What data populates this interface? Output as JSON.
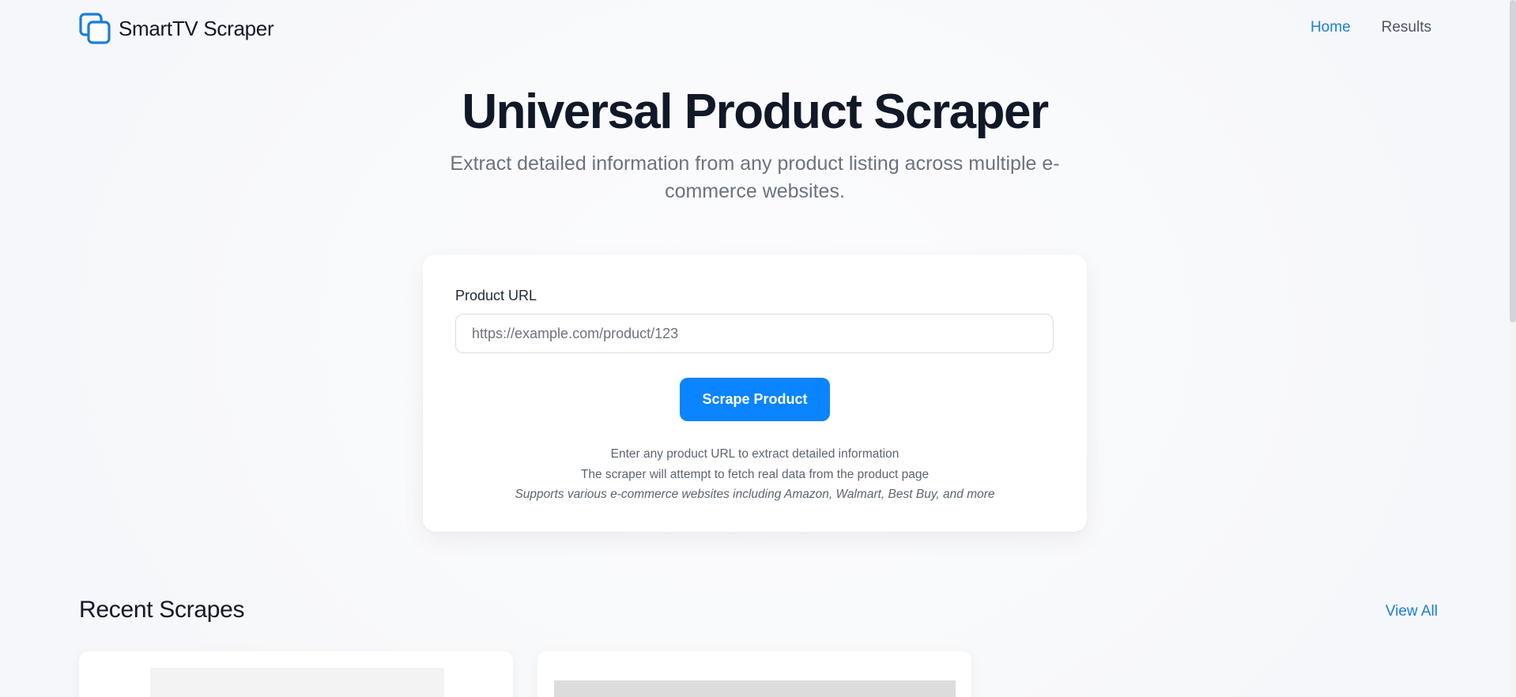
{
  "app": {
    "brand_name": "SmartTV Scraper",
    "brand_icon": "copy-squares-icon",
    "accent_color": "#0a84ff",
    "link_color": "#1a7ed6"
  },
  "nav": {
    "home": "Home",
    "results": "Results",
    "active": "Home"
  },
  "hero": {
    "title": "Universal Product Scraper",
    "subtitle": "Extract detailed information from any product listing across multiple e-commerce websites."
  },
  "form": {
    "label": "Product URL",
    "placeholder": "https://example.com/product/123",
    "value": "",
    "button": "Scrape Product",
    "help_line_1": "Enter any product URL to extract detailed information",
    "help_line_2": "The scraper will attempt to fetch real data from the product page",
    "help_line_3": "Supports various e-commerce websites including Amazon, Walmart, Best Buy, and more"
  },
  "recent": {
    "title": "Recent Scrapes",
    "view_all": "View All",
    "items": [
      {
        "thumbnail": "image-placeholder"
      },
      {
        "thumbnail": "image-placeholder"
      }
    ]
  }
}
